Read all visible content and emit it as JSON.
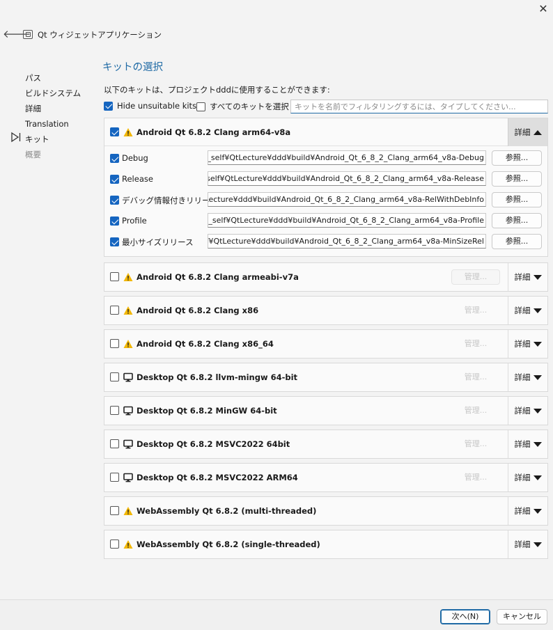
{
  "window": {
    "close_glyph": "✕"
  },
  "header": {
    "back_glyph": "🡐",
    "title": "Qt ウィジェットアプリケーション"
  },
  "steps": [
    {
      "label": "パス",
      "state": "done"
    },
    {
      "label": "ビルドシステム",
      "state": "done"
    },
    {
      "label": "詳細",
      "state": "done"
    },
    {
      "label": "Translation",
      "state": "done"
    },
    {
      "label": "キット",
      "state": "current"
    },
    {
      "label": "概要",
      "state": "pending"
    }
  ],
  "main": {
    "title": "キットの選択",
    "intro": "以下のキットは、プロジェクトdddに使用することができます:",
    "hide_unsuitable": {
      "label": "Hide unsuitable kits",
      "checked": true
    },
    "select_all": {
      "label": "すべてのキットを選択",
      "checked": false
    },
    "filter_placeholder": "キットを名前でフィルタリングするには、タイプしてください..."
  },
  "details_label": "詳細",
  "manage_label": "管理...",
  "browse_label": "参照...",
  "kits": [
    {
      "name": "Android Qt 6.8.2 Clang arm64-v8a",
      "icon": "warning-icon",
      "checked": true,
      "expanded": true,
      "build_configs": [
        {
          "label": "Debug",
          "checked": true,
          "path": "/src_self¥QtLecture¥ddd¥build¥Android_Qt_6_8_2_Clang_arm64_v8a-Debug"
        },
        {
          "label": "Release",
          "checked": true,
          "path": "/src_self¥QtLecture¥ddd¥build¥Android_Qt_6_8_2_Clang_arm64_v8a-Release"
        },
        {
          "label": "デバッグ情報付きリリース",
          "checked": true,
          "path": "QtLecture¥ddd¥build¥Android_Qt_6_8_2_Clang_arm64_v8a-RelWithDebInfo"
        },
        {
          "label": "Profile",
          "checked": true,
          "path": "/src_self¥QtLecture¥ddd¥build¥Android_Qt_6_8_2_Clang_arm64_v8a-Profile"
        },
        {
          "label": "最小サイズリリース",
          "checked": true,
          "path": "self¥QtLecture¥ddd¥build¥Android_Qt_6_8_2_Clang_arm64_v8a-MinSizeRel"
        }
      ]
    },
    {
      "name": "Android Qt 6.8.2 Clang armeabi-v7a",
      "icon": "warning-icon",
      "checked": false,
      "expanded": false,
      "manage_style": "visible"
    },
    {
      "name": "Android Qt 6.8.2 Clang x86",
      "icon": "warning-icon",
      "checked": false,
      "expanded": false,
      "manage_style": "faint"
    },
    {
      "name": "Android Qt 6.8.2 Clang x86_64",
      "icon": "warning-icon",
      "checked": false,
      "expanded": false,
      "manage_style": "faint"
    },
    {
      "name": "Desktop Qt 6.8.2 llvm-mingw 64-bit",
      "icon": "monitor-icon",
      "checked": false,
      "expanded": false,
      "manage_style": "faint"
    },
    {
      "name": "Desktop Qt 6.8.2 MinGW 64-bit",
      "icon": "monitor-icon",
      "checked": false,
      "expanded": false,
      "manage_style": "faint"
    },
    {
      "name": "Desktop Qt 6.8.2 MSVC2022 64bit",
      "icon": "monitor-icon",
      "checked": false,
      "expanded": false,
      "manage_style": "faint"
    },
    {
      "name": "Desktop Qt 6.8.2 MSVC2022 ARM64",
      "icon": "monitor-icon",
      "checked": false,
      "expanded": false,
      "manage_style": "faint"
    },
    {
      "name": "WebAssembly Qt 6.8.2 (multi-threaded)",
      "icon": "warning-icon",
      "checked": false,
      "expanded": false,
      "manage_style": "none"
    },
    {
      "name": "WebAssembly Qt 6.8.2 (single-threaded)",
      "icon": "warning-icon",
      "checked": false,
      "expanded": false,
      "manage_style": "none"
    }
  ],
  "footer": {
    "next_label": "次へ(N)",
    "cancel_label": "キャンセル"
  },
  "colors": {
    "accent": "#1f6aa5",
    "checkbox": "#1565c0",
    "warning": "#f2b705"
  }
}
